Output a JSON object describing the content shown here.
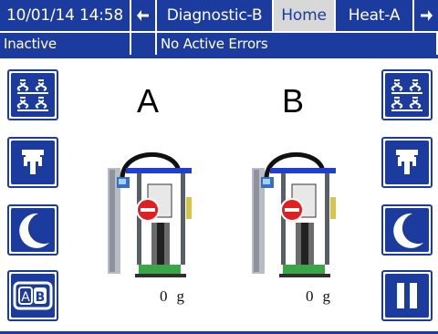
{
  "header": {
    "datetime": "10/01/14 14:58",
    "prev_screen": "Diagnostic-B",
    "current_screen": "Home",
    "next_screen": "Heat-A",
    "left_arrow_icon": "arrow-left-icon",
    "right_arrow_icon": "arrow-right-icon"
  },
  "status": {
    "state": "Inactive",
    "errors": "No Active Errors"
  },
  "pumps": [
    {
      "label": "A",
      "weight_value": "0",
      "weight_unit": "g"
    },
    {
      "label": "B",
      "weight_value": "0",
      "weight_unit": "g"
    }
  ],
  "left_buttons": [
    {
      "icon": "pump-grid-icon"
    },
    {
      "icon": "spray-gun-icon"
    },
    {
      "icon": "moon-icon"
    },
    {
      "icon": "ab-select-icon"
    }
  ],
  "right_buttons": [
    {
      "icon": "pump-grid-icon"
    },
    {
      "icon": "spray-gun-icon"
    },
    {
      "icon": "moon-icon"
    },
    {
      "icon": "pause-icon"
    }
  ],
  "colors": {
    "header_blue": "#1b3b9e",
    "active_tab": "#d8d8d8",
    "stop_red": "#e02020",
    "base_green": "#3aa648"
  }
}
